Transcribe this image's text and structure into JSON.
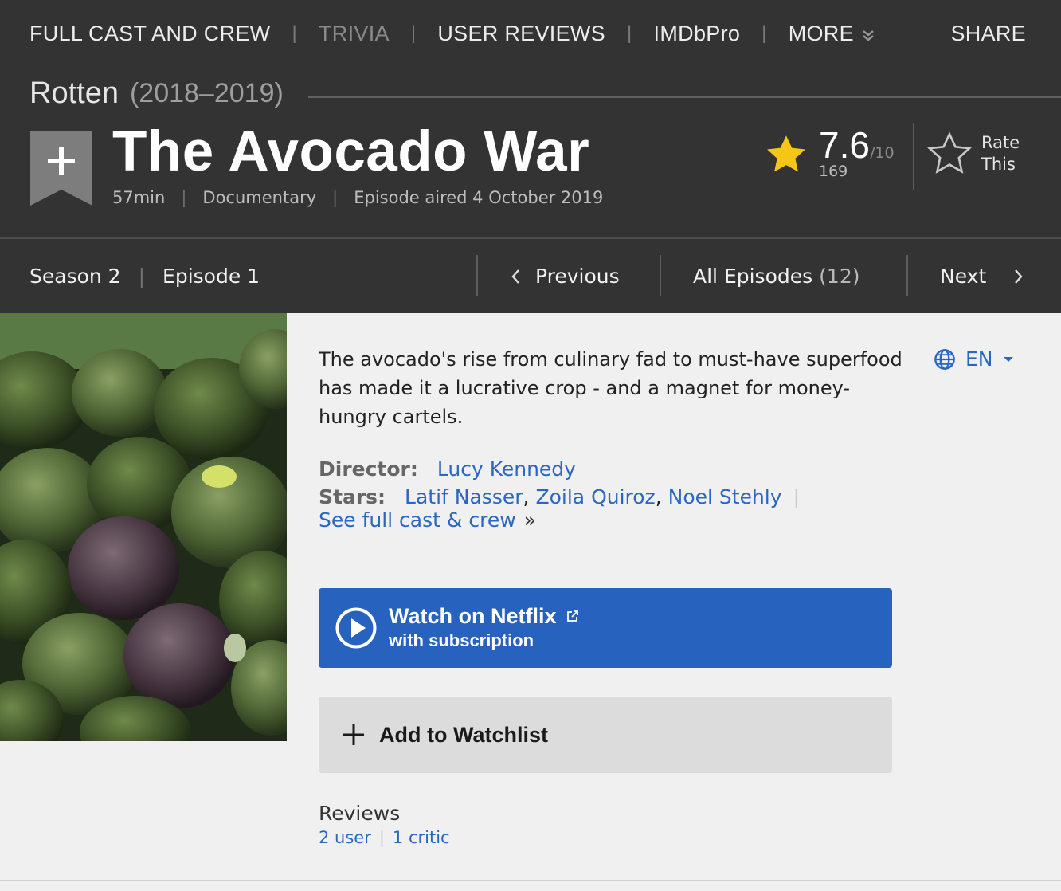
{
  "topnav": {
    "items": [
      "FULL CAST AND CREW",
      "TRIVIA",
      "USER REVIEWS",
      "IMDbPro",
      "MORE"
    ],
    "share": "SHARE"
  },
  "series": {
    "title": "Rotten",
    "years": "(2018–2019)"
  },
  "episode": {
    "title": "The Avocado War",
    "runtime": "57min",
    "genre": "Documentary",
    "aired": "Episode aired 4 October 2019"
  },
  "rating": {
    "value": "7.6",
    "scale": "/10",
    "count": "169",
    "rate_label_1": "Rate",
    "rate_label_2": "This"
  },
  "episode_nav": {
    "season": "Season 2",
    "episode": "Episode 1",
    "previous": "Previous",
    "all_episodes": "All Episodes",
    "all_count": "(12)",
    "next": "Next"
  },
  "plot": "The avocado's rise from culinary fad to must-have superfood has made it a lucrative crop - and a magnet for money-hungry cartels.",
  "language": "EN",
  "credits": {
    "director_label": "Director:",
    "director": "Lucy Kennedy",
    "stars_label": "Stars:",
    "stars": [
      "Latif Nasser",
      "Zoila Quiroz",
      "Noel Stehly"
    ],
    "see_full": "See full cast & crew",
    "raquo": "»"
  },
  "watch": {
    "line1": "Watch on Netflix",
    "line2": "with subscription"
  },
  "watchlist": {
    "label": "Add to Watchlist"
  },
  "reviews": {
    "heading": "Reviews",
    "user": "2 user",
    "critic": "1 critic"
  },
  "colors": {
    "header_bg": "#333333",
    "link": "#2b67c2",
    "watch_bg": "#2763be",
    "star": "#f5c518"
  },
  "icons": [
    "chevron-double-down-icon",
    "plus-ribbon-icon",
    "star-icon",
    "star-outline-icon",
    "chevron-left-icon",
    "chevron-right-icon",
    "globe-icon",
    "caret-down-icon",
    "play-icon",
    "external-link-icon",
    "plus-icon"
  ]
}
